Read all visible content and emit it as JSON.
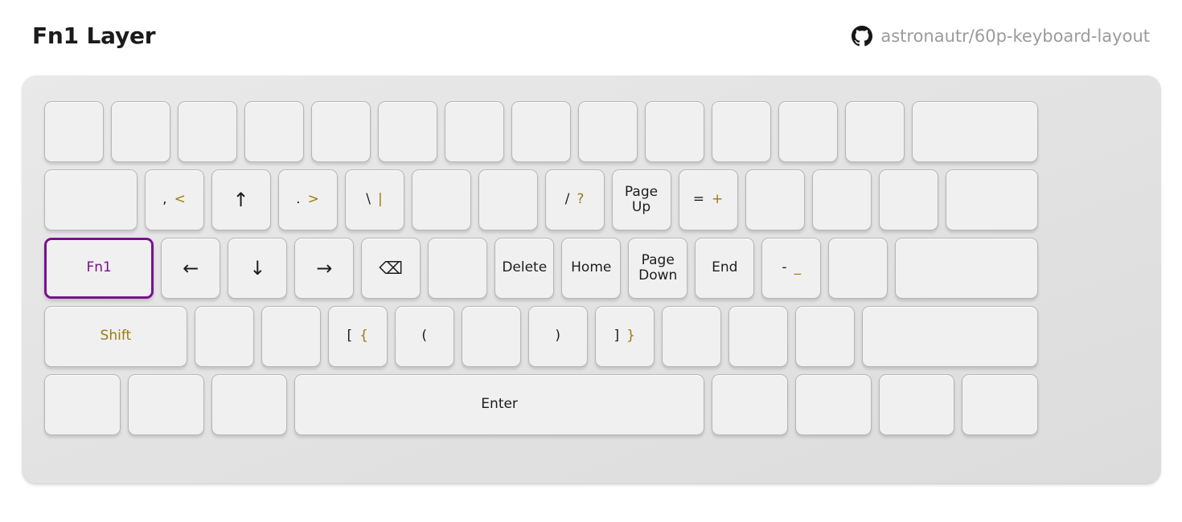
{
  "header": {
    "title": "Fn1 Layer",
    "repo_icon": "github-icon",
    "repo_text": "astronautr/60p-keyboard-layout"
  },
  "colors": {
    "accent_purple": "#7b1090",
    "legend_gold": "#9a7d0a",
    "legend_black": "#1d1d1d",
    "case": "#e3e3e3",
    "keycap": "#f0f0f0",
    "keycap_border": "#b6b6b6"
  },
  "keyboard": {
    "layout_name": "60p",
    "rows": [
      {
        "name": "row-1",
        "keys": [
          {
            "w": 1,
            "base": "",
            "shift": ""
          },
          {
            "w": 1,
            "base": "",
            "shift": ""
          },
          {
            "w": 1,
            "base": "",
            "shift": ""
          },
          {
            "w": 1,
            "base": "",
            "shift": ""
          },
          {
            "w": 1,
            "base": "",
            "shift": ""
          },
          {
            "w": 1,
            "base": "",
            "shift": ""
          },
          {
            "w": 1,
            "base": "",
            "shift": ""
          },
          {
            "w": 1,
            "base": "",
            "shift": ""
          },
          {
            "w": 1,
            "base": "",
            "shift": ""
          },
          {
            "w": 1,
            "base": "",
            "shift": ""
          },
          {
            "w": 1,
            "base": "",
            "shift": ""
          },
          {
            "w": 1,
            "base": "",
            "shift": ""
          },
          {
            "w": 1,
            "base": "",
            "shift": ""
          },
          {
            "w": 2,
            "base": "",
            "shift": ""
          }
        ]
      },
      {
        "name": "row-2",
        "keys": [
          {
            "w": 1.5,
            "base": "",
            "shift": ""
          },
          {
            "w": 1,
            "base": ",",
            "shift": "<"
          },
          {
            "w": 1,
            "glyph": "↑"
          },
          {
            "w": 1,
            "base": ".",
            "shift": ">"
          },
          {
            "w": 1,
            "base": "\\",
            "shift": "|"
          },
          {
            "w": 1,
            "base": "",
            "shift": ""
          },
          {
            "w": 1,
            "base": "",
            "shift": ""
          },
          {
            "w": 1,
            "base": "/",
            "shift": "?"
          },
          {
            "w": 1,
            "word": "Page\nUp"
          },
          {
            "w": 1,
            "base": "=",
            "shift": "+"
          },
          {
            "w": 1,
            "base": "",
            "shift": ""
          },
          {
            "w": 1,
            "base": "",
            "shift": ""
          },
          {
            "w": 1,
            "base": "",
            "shift": ""
          },
          {
            "w": 1.5,
            "base": "",
            "shift": ""
          }
        ]
      },
      {
        "name": "row-3",
        "keys": [
          {
            "w": 1.75,
            "word": "Fn1",
            "style": "purple",
            "highlight": true
          },
          {
            "w": 1,
            "glyph": "←"
          },
          {
            "w": 1,
            "glyph": "↓"
          },
          {
            "w": 1,
            "glyph": "→"
          },
          {
            "w": 1,
            "glyph": "⌫",
            "glyph_name": "backspace-icon"
          },
          {
            "w": 1,
            "base": "",
            "shift": ""
          },
          {
            "w": 1,
            "word": "Delete"
          },
          {
            "w": 1,
            "word": "Home"
          },
          {
            "w": 1,
            "word": "Page\nDown"
          },
          {
            "w": 1,
            "word": "End"
          },
          {
            "w": 1,
            "base": "-",
            "shift": "_"
          },
          {
            "w": 1,
            "base": "",
            "shift": ""
          },
          {
            "w": 2.25,
            "base": "",
            "shift": ""
          }
        ]
      },
      {
        "name": "row-4",
        "keys": [
          {
            "w": 2.25,
            "word": "Shift",
            "style": "gold"
          },
          {
            "w": 1,
            "base": "",
            "shift": ""
          },
          {
            "w": 1,
            "base": "",
            "shift": ""
          },
          {
            "w": 1,
            "base": "[",
            "shift": "{"
          },
          {
            "w": 1,
            "base": "(",
            "shift": ""
          },
          {
            "w": 1,
            "base": "",
            "shift": ""
          },
          {
            "w": 1,
            "base": ")",
            "shift": ""
          },
          {
            "w": 1,
            "base": "]",
            "shift": "}"
          },
          {
            "w": 1,
            "base": "",
            "shift": ""
          },
          {
            "w": 1,
            "base": "",
            "shift": ""
          },
          {
            "w": 1,
            "base": "",
            "shift": ""
          },
          {
            "w": 2.75,
            "base": "",
            "shift": ""
          }
        ]
      },
      {
        "name": "row-5",
        "keys": [
          {
            "w": 1.25,
            "base": "",
            "shift": ""
          },
          {
            "w": 1.25,
            "base": "",
            "shift": ""
          },
          {
            "w": 1.25,
            "base": "",
            "shift": ""
          },
          {
            "w": 6.25,
            "word": "Enter"
          },
          {
            "w": 1.25,
            "base": "",
            "shift": ""
          },
          {
            "w": 1.25,
            "base": "",
            "shift": ""
          },
          {
            "w": 1.25,
            "base": "",
            "shift": ""
          },
          {
            "w": 1.25,
            "base": "",
            "shift": ""
          }
        ]
      }
    ]
  }
}
